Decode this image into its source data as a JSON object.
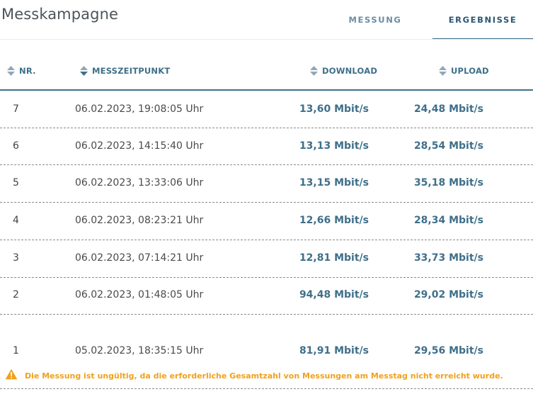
{
  "header": {
    "title": "Messkampagne",
    "tabs": [
      {
        "label": "MESSUNG",
        "active": false
      },
      {
        "label": "ERGEBNISSE",
        "active": true
      }
    ]
  },
  "table": {
    "columns": {
      "nr": "NR.",
      "zeit": "MESSZEITPUNKT",
      "download": "DOWNLOAD",
      "upload": "UPLOAD"
    },
    "rows": [
      {
        "nr": "7",
        "zeit": "06.02.2023, 19:08:05 Uhr",
        "download": "13,60 Mbit/s",
        "upload": "24,48 Mbit/s"
      },
      {
        "nr": "6",
        "zeit": "06.02.2023, 14:15:40 Uhr",
        "download": "13,13 Mbit/s",
        "upload": "28,54 Mbit/s"
      },
      {
        "nr": "5",
        "zeit": "06.02.2023, 13:33:06 Uhr",
        "download": "13,15 Mbit/s",
        "upload": "35,18 Mbit/s"
      },
      {
        "nr": "4",
        "zeit": "06.02.2023, 08:23:21 Uhr",
        "download": "12,66 Mbit/s",
        "upload": "28,34 Mbit/s"
      },
      {
        "nr": "3",
        "zeit": "06.02.2023, 07:14:21 Uhr",
        "download": "12,81 Mbit/s",
        "upload": "33,73 Mbit/s"
      },
      {
        "nr": "2",
        "zeit": "06.02.2023, 01:48:05 Uhr",
        "download": "94,48 Mbit/s",
        "upload": "29,02 Mbit/s"
      },
      {
        "nr": "1",
        "zeit": "05.02.2023, 18:35:15 Uhr",
        "download": "81,91 Mbit/s",
        "upload": "29,56 Mbit/s"
      }
    ],
    "warning": "Die Messung ist ungültig, da die erforderliche Gesamtzahl von Messungen am Messtag nicht erreicht wurde."
  },
  "colors": {
    "accent": "#3f6f8a",
    "warning": "#f0a11b"
  },
  "icons": {
    "sort": "sort-icon",
    "warning": "warning-icon"
  }
}
